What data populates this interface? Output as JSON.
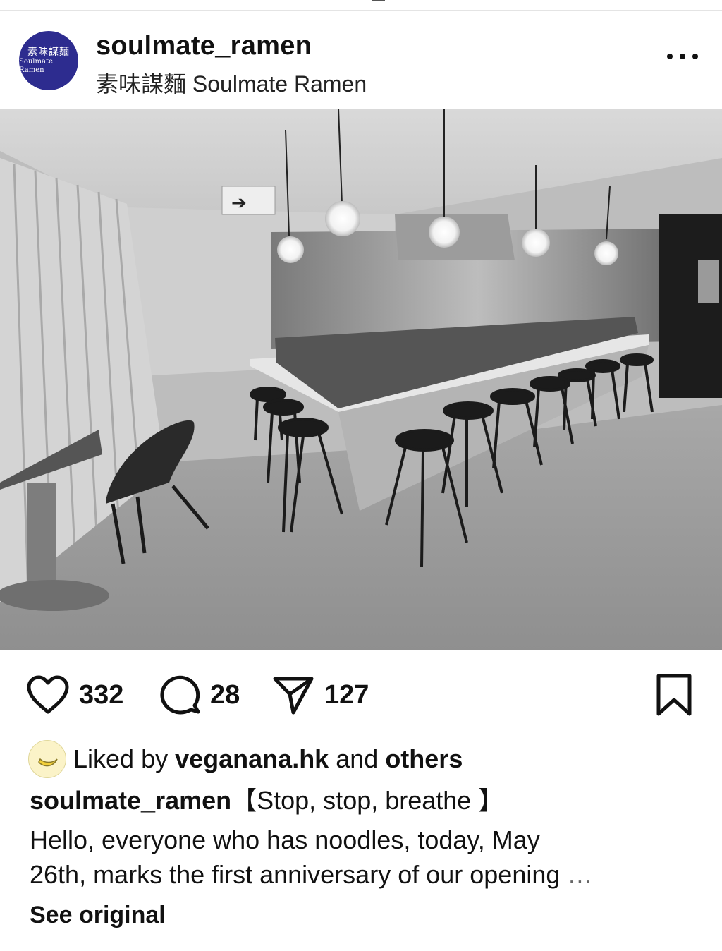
{
  "header": {
    "username": "soulmate_ramen",
    "subtitle": "素味謀麵 Soulmate Ramen",
    "avatar_text_cn": "素味謀麵",
    "avatar_text_en": "Soulmate Ramen",
    "more_icon": "more-horizontal-icon"
  },
  "photo": {
    "description_icon": "post-photo"
  },
  "actions": {
    "likes": "332",
    "comments": "28",
    "shares": "127"
  },
  "liked_by": {
    "prefix": "Liked by",
    "user": "veganana.hk",
    "middle": "and",
    "suffix": "others"
  },
  "caption": {
    "username": "soulmate_ramen",
    "headline": "【Stop, stop, breathe 】",
    "line1": "Hello, everyone who has noodles, today, May",
    "line2": "26th, marks the first anniversary of our opening",
    "ellipsis": "…"
  },
  "see_original": "See original",
  "colors": {
    "avatar_bg": "#2d2c8f",
    "text": "#111111"
  }
}
